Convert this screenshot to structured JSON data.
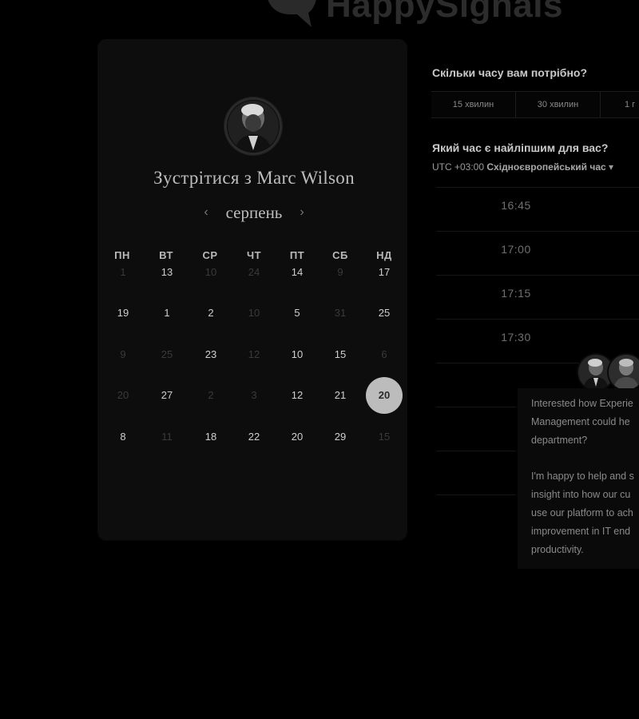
{
  "brand": {
    "name": "HappySignals"
  },
  "calendar": {
    "title": "Зустрітися з Marc Wilson",
    "month": "серпень",
    "prev_icon": "‹",
    "next_icon": "›",
    "weekdays": [
      "ПН",
      "ВТ",
      "СР",
      "ЧТ",
      "ПТ",
      "СБ",
      "НД"
    ],
    "weeks": [
      [
        {
          "d": "1",
          "dim": true
        },
        {
          "d": "13",
          "dim": false
        },
        {
          "d": "10",
          "dim": true
        },
        {
          "d": "24",
          "dim": true
        },
        {
          "d": "14",
          "dim": false
        },
        {
          "d": "9",
          "dim": true
        },
        {
          "d": "17",
          "dim": false
        }
      ],
      [
        {
          "d": "19",
          "dim": false
        },
        {
          "d": "1",
          "dim": false
        },
        {
          "d": "2",
          "dim": false
        },
        {
          "d": "10",
          "dim": true
        },
        {
          "d": "5",
          "dim": false
        },
        {
          "d": "31",
          "dim": true
        },
        {
          "d": "25",
          "dim": false
        }
      ],
      [
        {
          "d": "9",
          "dim": true
        },
        {
          "d": "25",
          "dim": true
        },
        {
          "d": "23",
          "dim": false
        },
        {
          "d": "12",
          "dim": true
        },
        {
          "d": "10",
          "dim": false
        },
        {
          "d": "15",
          "dim": false
        },
        {
          "d": "6",
          "dim": true
        }
      ],
      [
        {
          "d": "20",
          "dim": true
        },
        {
          "d": "27",
          "dim": false
        },
        {
          "d": "2",
          "dim": true
        },
        {
          "d": "3",
          "dim": true
        },
        {
          "d": "12",
          "dim": false
        },
        {
          "d": "21",
          "dim": false
        },
        {
          "d": "20",
          "dim": false,
          "selected": true
        }
      ],
      [
        {
          "d": "8",
          "dim": false
        },
        {
          "d": "11",
          "dim": true
        },
        {
          "d": "18",
          "dim": false
        },
        {
          "d": "22",
          "dim": false
        },
        {
          "d": "20",
          "dim": false
        },
        {
          "d": "29",
          "dim": false
        },
        {
          "d": "15",
          "dim": true
        }
      ]
    ]
  },
  "duration": {
    "heading": "Скільки часу вам потрібно?",
    "options": [
      "15 хвилин",
      "30 хвилин",
      "1 г"
    ]
  },
  "time": {
    "heading": "Який час є найліпшим для вас?",
    "tz_offset": "UTC +03:00",
    "tz_name": "Східноєвропейський час",
    "tz_caret": "▾",
    "slots": [
      "16:45",
      "17:00",
      "17:15",
      "17:30"
    ]
  },
  "chat": {
    "paragraph1": [
      "Interested how Experie",
      "Management could he",
      "department?"
    ],
    "paragraph2": [
      "I'm happy to help and s",
      "insight into how our cu",
      "use our platform to ach",
      "improvement in IT end",
      "productivity."
    ]
  },
  "colors": {
    "background": "#000000",
    "card": "#0d0d0d",
    "selected_day": "#bcbcbc"
  },
  "icons": {
    "logo": "speech-bubble-heart-icon",
    "prev": "chevron-left-icon",
    "next": "chevron-right-icon",
    "tz_dropdown": "caret-down-icon"
  }
}
